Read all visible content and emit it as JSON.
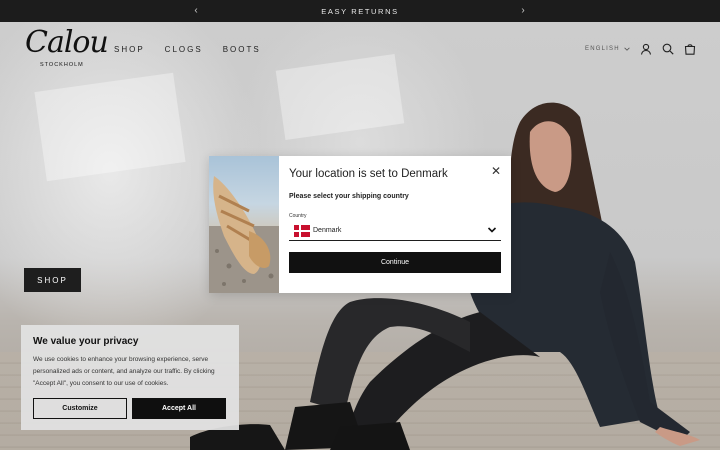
{
  "announcement": {
    "text": "EASY RETURNS",
    "prev_icon": "chevron-left-icon",
    "next_icon": "chevron-right-icon"
  },
  "header": {
    "logo_script": "Calou",
    "logo_sub": "STOCKHOLM",
    "nav": [
      "SHOP",
      "CLOGS",
      "BOOTS"
    ],
    "language": "ENGLISH",
    "icons": [
      "account-icon",
      "search-icon",
      "cart-icon"
    ]
  },
  "hero": {
    "shop_label": "SHOP"
  },
  "modal": {
    "title": "Your location is set to Denmark",
    "subtitle": "Please select your shipping country",
    "country_label": "Country",
    "country_value": "Denmark",
    "continue_label": "Continue"
  },
  "cookie": {
    "title": "We value your privacy",
    "text": "We use cookies to enhance your browsing experience, serve personalized ads or content, and analyze our traffic. By clicking \"Accept All\", you consent to our use of cookies.",
    "customize_label": "Customize",
    "accept_label": "Accept All"
  },
  "colors": {
    "dark": "#1c1c1c",
    "flag_red": "#c8102e"
  }
}
